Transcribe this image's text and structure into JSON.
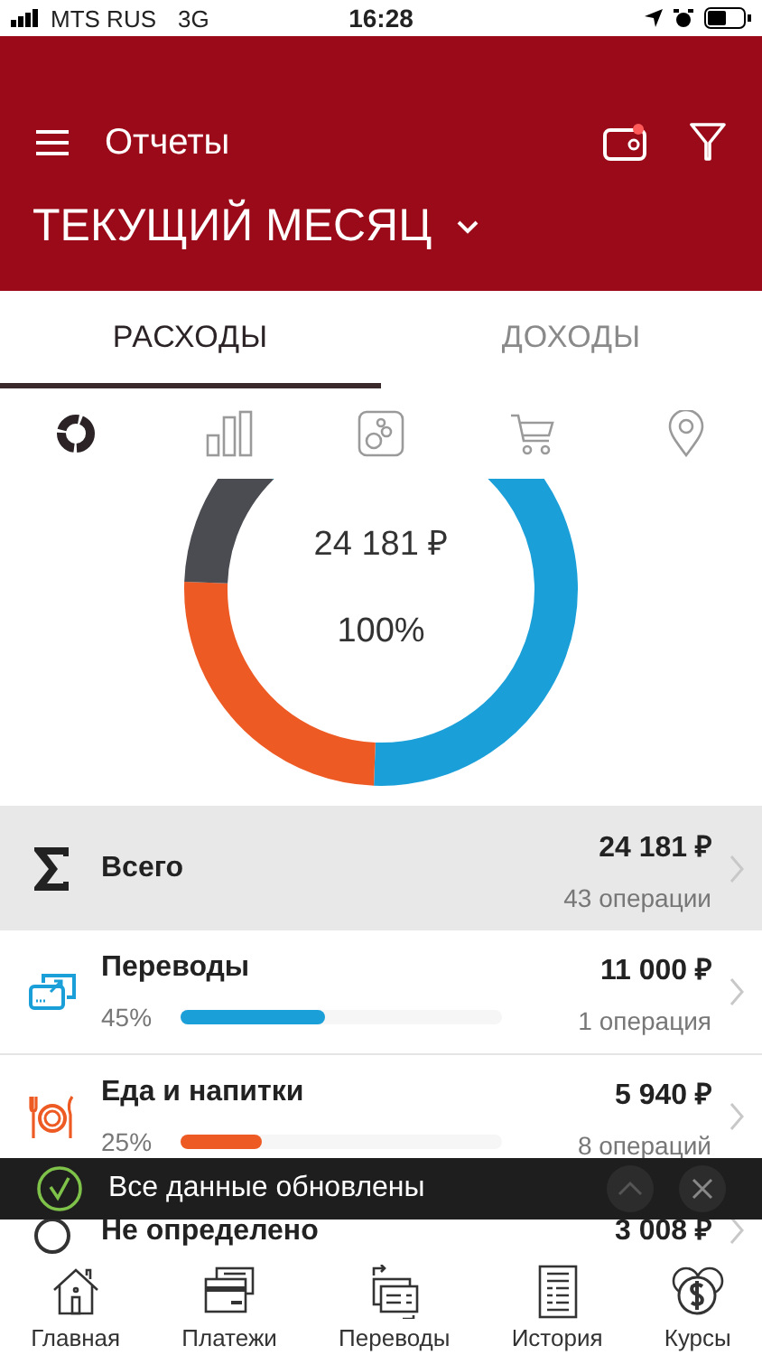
{
  "status_bar": {
    "carrier": "MTS RUS",
    "network": "3G",
    "time": "16:28"
  },
  "header": {
    "title": "Отчеты",
    "period": "ТЕКУЩИЙ МЕСЯЦ",
    "wallet_badge": true
  },
  "tabs": [
    {
      "label": "РАСХОДЫ",
      "selected": true
    },
    {
      "label": "ДОХОДЫ",
      "selected": false
    }
  ],
  "view_icons": [
    {
      "kind": "donut",
      "selected": true
    },
    {
      "kind": "bars",
      "selected": false
    },
    {
      "kind": "bubbles",
      "selected": false
    },
    {
      "kind": "cart",
      "selected": false
    },
    {
      "kind": "pin",
      "selected": false
    }
  ],
  "donut": {
    "amount": "24 181 ₽",
    "percent": "100%"
  },
  "total": {
    "label": "Всего",
    "amount": "24 181 ₽",
    "count": "43 операции"
  },
  "categories": [
    {
      "kind": "transfer",
      "name": "Переводы",
      "percent": "45%",
      "level": 0.45,
      "color": "#1a9fd8",
      "amount": "11 000 ₽",
      "count": "1 операция"
    },
    {
      "kind": "food",
      "name": "Еда и напитки",
      "percent": "25%",
      "level": 0.25,
      "color": "#ee5a24",
      "amount": "5 940 ₽",
      "count": "8 операций"
    },
    {
      "kind": "unknown",
      "name": "Не определено",
      "amount": "3 008 ₽"
    }
  ],
  "snackbar": {
    "message": "Все данные обновлены"
  },
  "nav": [
    {
      "kind": "home",
      "label": "Главная"
    },
    {
      "kind": "card",
      "label": "Платежи"
    },
    {
      "kind": "transfer",
      "label": "Переводы"
    },
    {
      "kind": "history",
      "label": "История"
    },
    {
      "kind": "rates",
      "label": "Курсы"
    }
  ]
}
